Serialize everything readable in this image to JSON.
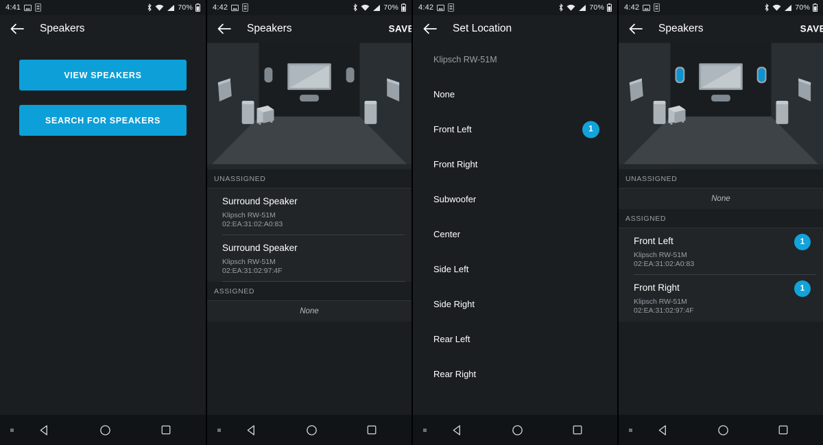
{
  "colors": {
    "accent": "#0d9fd8",
    "badge": "#12a3da",
    "bg": "#1b1e21",
    "list_bg": "#212528",
    "muted_text": "#9aa0a6"
  },
  "status_bar": {
    "time_1": "4:41",
    "time_2": "4:42",
    "battery": "70%",
    "icons": [
      "image-icon",
      "sim-icon",
      "bluetooth-icon",
      "wifi-icon",
      "signal-icon",
      "battery-icon"
    ]
  },
  "nav_bar": {
    "back_label": "back-triangle",
    "home_label": "home-circle",
    "recents_label": "recents-square"
  },
  "screens": [
    {
      "id": "speakers-empty",
      "title": "Speakers",
      "time": "4:41",
      "save_label": "",
      "buttons": [
        {
          "label": "VIEW SPEAKERS",
          "name": "view-speakers-button"
        },
        {
          "label": "SEARCH FOR SPEAKERS",
          "name": "search-for-speakers-button"
        }
      ]
    },
    {
      "id": "speakers-unassigned",
      "title": "Speakers",
      "time": "4:42",
      "save_label": "SAVE",
      "sections": [
        {
          "header": "UNASSIGNED",
          "rows": [
            {
              "title": "Surround Speaker",
              "model": "Klipsch RW-51M",
              "mac": "02:EA:31:02:A0:83",
              "badge": ""
            },
            {
              "title": "Surround Speaker",
              "model": "Klipsch RW-51M",
              "mac": "02:EA:31:02:97:4F",
              "badge": ""
            }
          ],
          "empty": ""
        },
        {
          "header": "ASSIGNED",
          "rows": [],
          "empty": "None"
        }
      ]
    },
    {
      "id": "set-location",
      "title": "Set Location",
      "time": "4:42",
      "save_label": "",
      "device_name": "Klipsch RW-51M",
      "locations": [
        {
          "label": "None",
          "badge": ""
        },
        {
          "label": "Front Left",
          "badge": "1"
        },
        {
          "label": "Front Right",
          "badge": ""
        },
        {
          "label": "Subwoofer",
          "badge": ""
        },
        {
          "label": "Center",
          "badge": ""
        },
        {
          "label": "Side Left",
          "badge": ""
        },
        {
          "label": "Side Right",
          "badge": ""
        },
        {
          "label": "Rear Left",
          "badge": ""
        },
        {
          "label": "Rear Right",
          "badge": ""
        }
      ]
    },
    {
      "id": "speakers-assigned",
      "title": "Speakers",
      "time": "4:42",
      "save_label": "SAVE",
      "sections": [
        {
          "header": "UNASSIGNED",
          "rows": [],
          "empty": "None"
        },
        {
          "header": "ASSIGNED",
          "rows": [
            {
              "title": "Front Left",
              "model": "Klipsch RW-51M",
              "mac": "02:EA:31:02:A0:83",
              "badge": "1"
            },
            {
              "title": "Front Right",
              "model": "Klipsch RW-51M",
              "mac": "02:EA:31:02:97:4F",
              "badge": "1"
            }
          ],
          "empty": ""
        }
      ]
    }
  ]
}
